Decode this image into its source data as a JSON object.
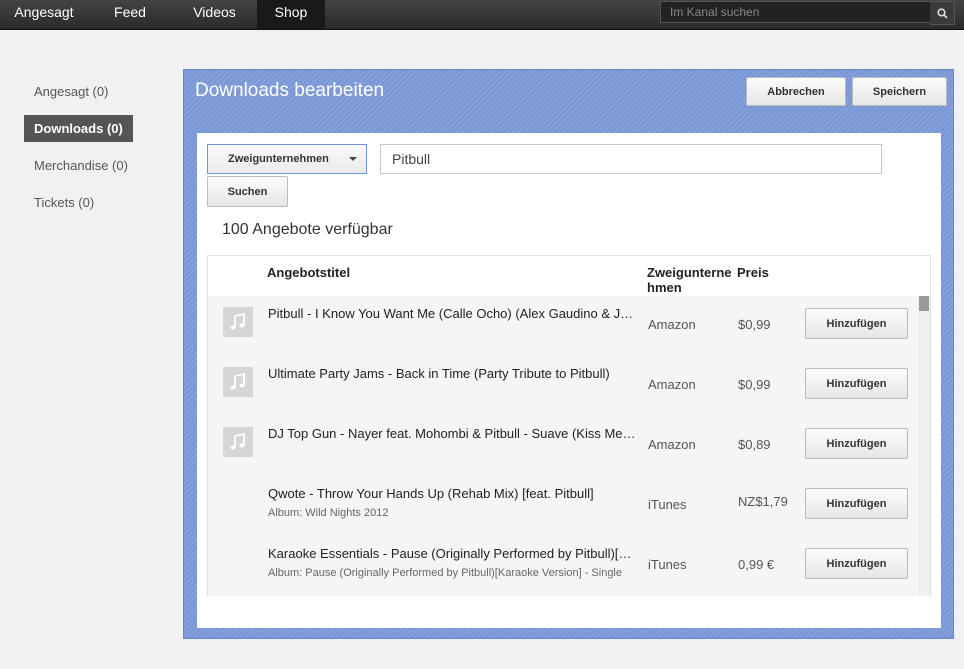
{
  "topnav": {
    "tabs": [
      {
        "label": "Angesagt",
        "active": false
      },
      {
        "label": "Feed",
        "active": false
      },
      {
        "label": "Videos",
        "active": false
      },
      {
        "label": "Shop",
        "active": true
      }
    ],
    "search_placeholder": "Im Kanal suchen",
    "search_icon": "search-icon"
  },
  "sidebar": {
    "items": [
      {
        "label": "Angesagt (0)",
        "active": false
      },
      {
        "label": "Downloads (0)",
        "active": true
      },
      {
        "label": "Merchandise (0)",
        "active": false
      },
      {
        "label": "Tickets (0)",
        "active": false
      }
    ]
  },
  "panel": {
    "title": "Downloads bearbeiten",
    "cancel_label": "Abbrechen",
    "save_label": "Speichern",
    "accent_color": "#7b98d6"
  },
  "search": {
    "filter_selected": "Zweigunternehmen",
    "query_value": "Pitbull",
    "search_label": "Suchen",
    "result_count": "100 Angebote verfügbar"
  },
  "table": {
    "headers": {
      "title": "Angebotstitel",
      "store": "Zweigunternehmen",
      "price": "Preis"
    },
    "rows": [
      {
        "title": "Pitbull - I Know You Want Me (Calle Ocho) (Alex Gaudino & Jason Rooney Remix)",
        "album": "",
        "store": "Amazon",
        "price": "$0,99",
        "has_thumb": true,
        "action": "Hinzufügen"
      },
      {
        "title": "Ultimate Party Jams - Back in Time (Party Tribute to Pitbull)",
        "album": "",
        "store": "Amazon",
        "price": "$0,99",
        "has_thumb": true,
        "action": "Hinzufügen"
      },
      {
        "title": "DJ Top Gun - Nayer feat. Mohombi & Pitbull - Suave (Kiss Me) (Remix)",
        "album": "",
        "store": "Amazon",
        "price": "$0,89",
        "has_thumb": true,
        "action": "Hinzufügen"
      },
      {
        "title": "Qwote - Throw Your Hands Up (Rehab Mix) [feat. Pitbull]",
        "album": "Album: Wild Nights 2012",
        "store": "iTunes",
        "price": "NZ$1,79",
        "has_thumb": false,
        "action": "Hinzufügen"
      },
      {
        "title": "Karaoke Essentials - Pause (Originally Performed by Pitbull)[Karaoke Version]",
        "album": "Album: Pause (Originally Performed by Pitbull)[Karaoke Version] - Single",
        "store": "iTunes",
        "price": "0,99 €",
        "has_thumb": false,
        "action": "Hinzufügen"
      }
    ]
  }
}
